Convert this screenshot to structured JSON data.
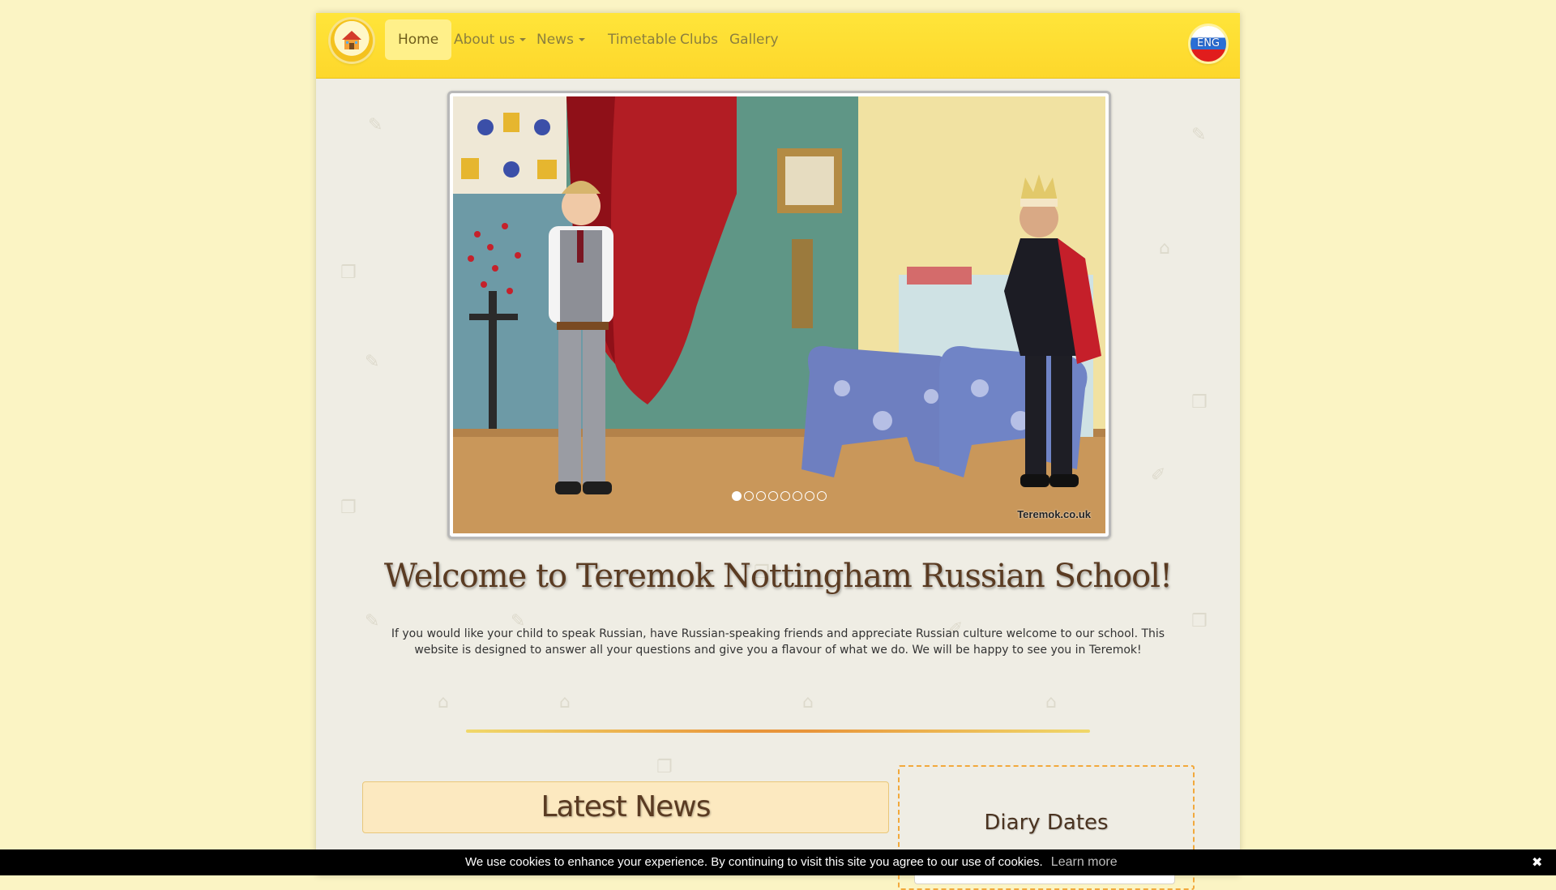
{
  "colors": {
    "navbar": "#fdd72b",
    "page_background": "#fbf4c4",
    "content_background": "#efede4",
    "title_text": "#5a3b22",
    "divider_accent": "#e8953a",
    "cookie_bar": "#000000"
  },
  "navbar": {
    "logo_icon": "teremok-logo-icon",
    "items": [
      {
        "label": "Home",
        "active": true
      },
      {
        "label": "About us",
        "dropdown": true
      },
      {
        "label": "News",
        "dropdown": true
      },
      {
        "label": "Timetable"
      },
      {
        "label": "Clubs"
      },
      {
        "label": "Gallery"
      }
    ],
    "language": "ENG"
  },
  "slider": {
    "dots_total": 8,
    "active_dot": 1,
    "watermark": "Teremok.co.uk"
  },
  "welcome": {
    "title": "Welcome to Teremok Nottingham Russian School!",
    "text": "If you would like your child to speak Russian, have Russian-speaking friends and appreciate Russian culture welcome to our school. This website is designed to answer all your questions and give you a flavour of what we do. We will be happy to see you in Teremok!"
  },
  "latest_news": {
    "title": "Latest News"
  },
  "diary": {
    "title": "Diary Dates"
  },
  "cookie": {
    "text": "We use cookies to enhance your experience. By continuing to visit this site you agree to our use of cookies.",
    "link": "Learn more",
    "close": "✖"
  }
}
